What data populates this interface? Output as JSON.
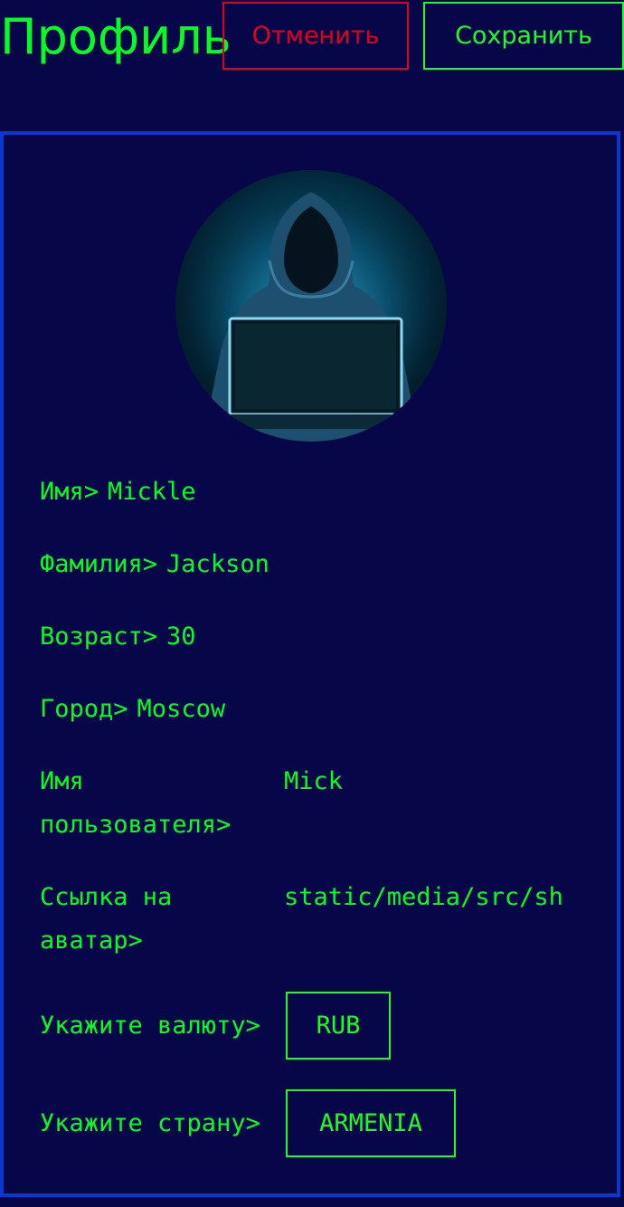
{
  "header": {
    "title": "Профиль",
    "cancel_label": "Отменить",
    "save_label": "Сохранить"
  },
  "profile": {
    "first_name_label": "Имя>",
    "first_name": "Mickle",
    "last_name_label": "Фамилия>",
    "last_name": "Jackson",
    "age_label": "Возраст>",
    "age": "30",
    "city_label": "Город>",
    "city": "Moscow",
    "username_label": "Имя пользователя>",
    "username": "Mick",
    "avatar_link_label": "Ссылка на аватар>",
    "avatar_link": "static/media/src/sh",
    "currency_label": "Укажите валюту>",
    "currency": "RUB",
    "country_label": "Укажите страну>",
    "country": "ARMENIA"
  },
  "colors": {
    "background": "#070649",
    "accent_green": "#00ff22",
    "cancel_red": "#e0001a",
    "panel_border": "#0a38cc"
  },
  "icons": {
    "avatar": "hooded-hacker-avatar"
  }
}
